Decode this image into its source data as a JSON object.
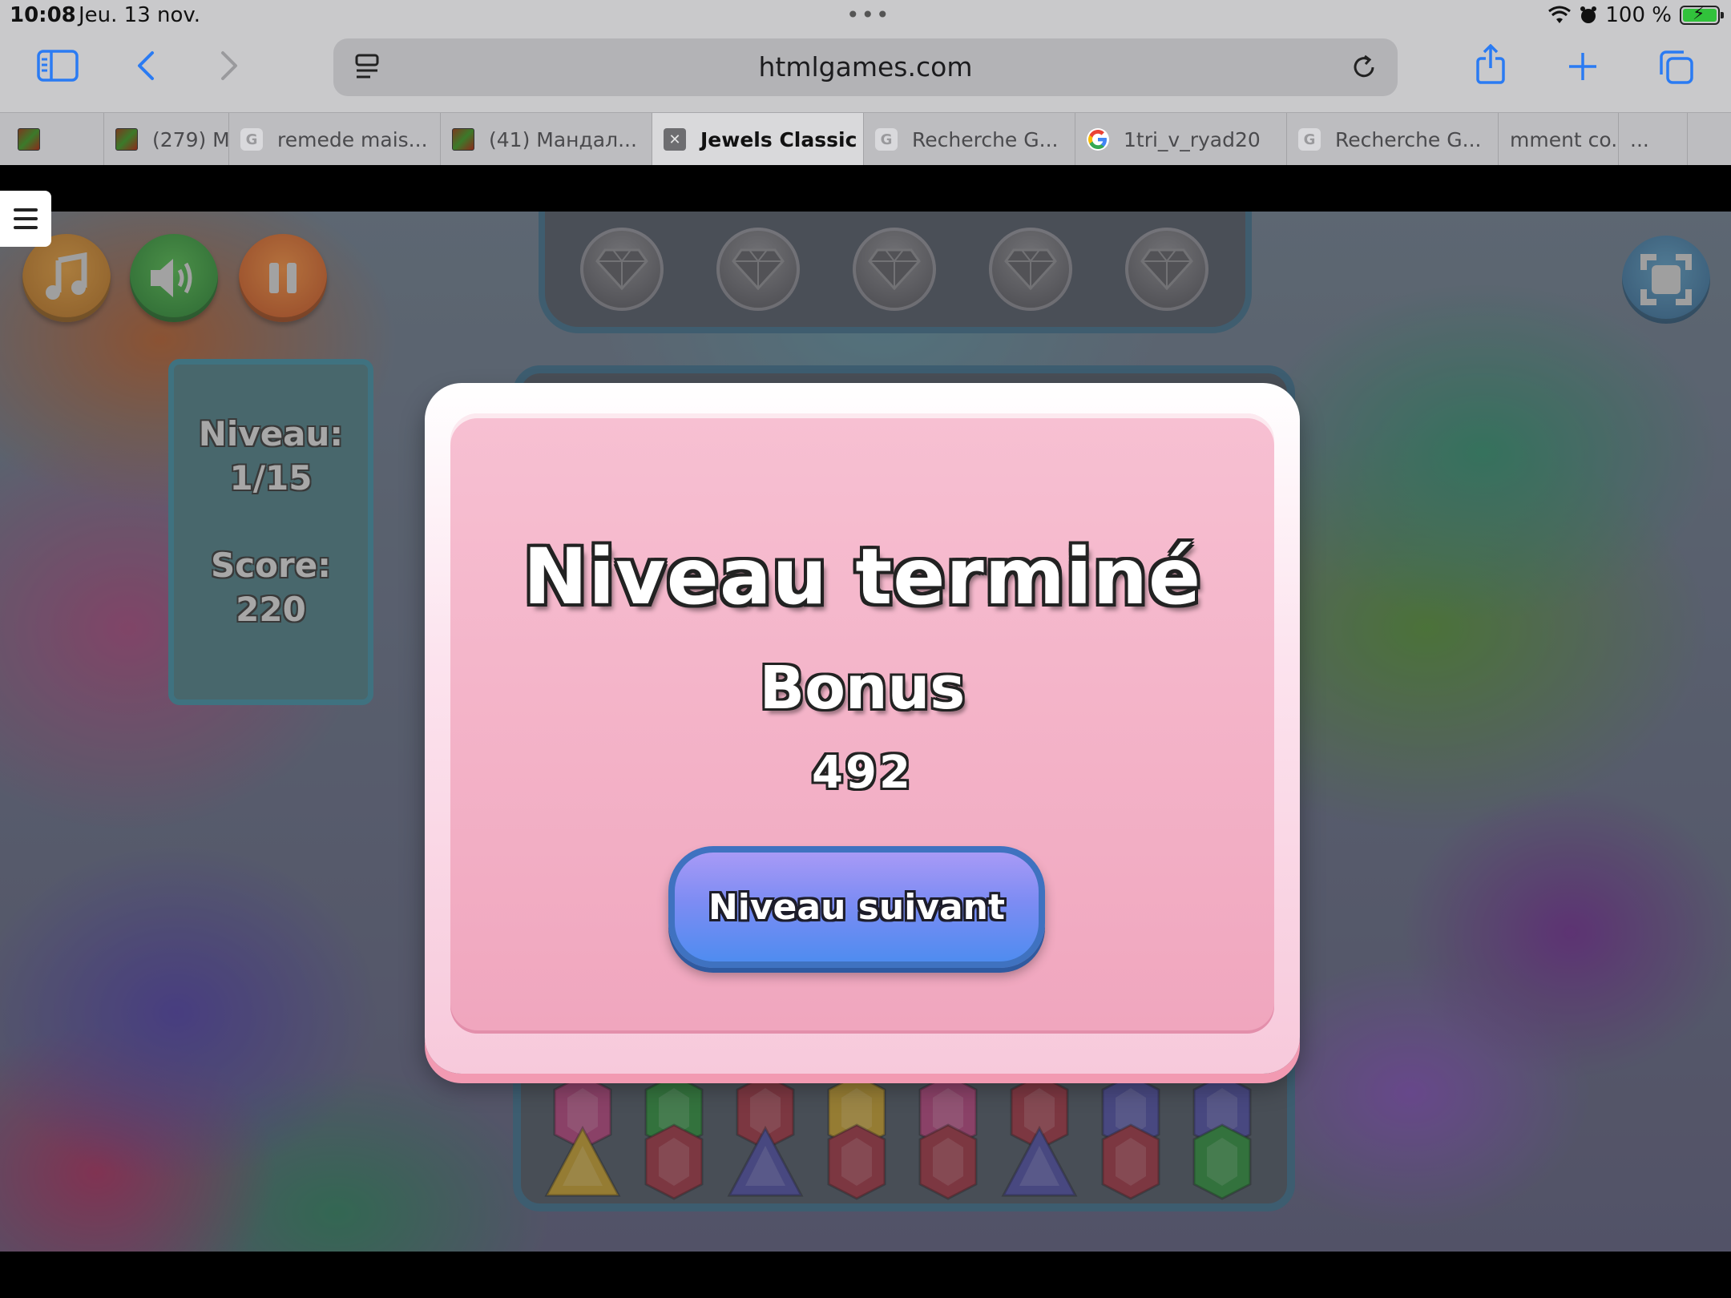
{
  "status_bar": {
    "time": "10:08",
    "date": "Jeu. 13 nov.",
    "battery_text": "100 %",
    "battery_level": 1.0
  },
  "browser": {
    "url": "htmlgames.com",
    "tabs": [
      {
        "label": "",
        "favicon": "image",
        "active": false
      },
      {
        "label": "(279) M",
        "favicon": "image",
        "active": false
      },
      {
        "label": "remede mais...",
        "favicon": "G",
        "active": false
      },
      {
        "label": "(41) Мандал...",
        "favicon": "image",
        "active": false
      },
      {
        "label": "Jewels Classic",
        "favicon": "close",
        "active": true
      },
      {
        "label": "Recherche G...",
        "favicon": "G",
        "active": false
      },
      {
        "label": "1tri_v_ryad20",
        "favicon": "google",
        "active": false
      },
      {
        "label": "Recherche G...",
        "favicon": "G",
        "active": false
      },
      {
        "label": "mment co...",
        "favicon": "none",
        "active": false
      },
      {
        "label": "...",
        "favicon": "none",
        "active": false
      }
    ]
  },
  "game": {
    "stats": {
      "level_label": "Niveau:",
      "level_value": "1/15",
      "score_label": "Score:",
      "score_value": "220"
    },
    "buttons": {
      "music_icon": "music-note-icon",
      "sound_icon": "speaker-icon",
      "pause_icon": "pause-icon",
      "fullscreen_icon": "fullscreen-icon"
    },
    "gem_slots": 5,
    "visible_bottom_row": [
      "yellow-triangle",
      "red-hexagon",
      "blue-triangle",
      "red-hexagon",
      "red-hexagon",
      "blue-triangle",
      "red-hexagon",
      "green-hexagon"
    ],
    "visible_partial_row": [
      "pink-gem",
      "green-gem",
      "red-gem",
      "yellow-gem",
      "pink-gem",
      "red-gem",
      "blue-gem",
      "blue-gem"
    ]
  },
  "modal": {
    "title": "Niveau terminé",
    "bonus_label": "Bonus",
    "bonus_value": "492",
    "next_button": "Niveau suivant"
  },
  "colors": {
    "modal_pink": "#f0a6be",
    "button_blue": "#4f8cf0",
    "music_button": "#c8802a",
    "sound_button": "#2f8a3a",
    "pause_button": "#d0632a",
    "fullscreen_button": "#2b5e8a"
  }
}
